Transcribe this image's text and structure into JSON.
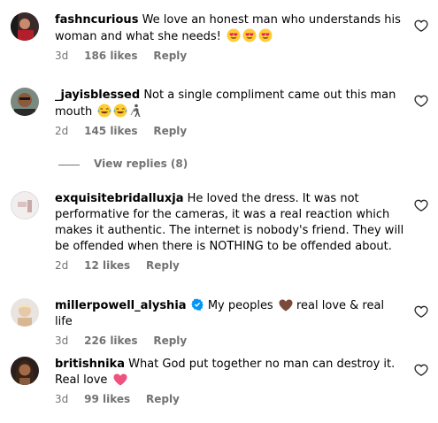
{
  "comments": [
    {
      "username": "fashncurious",
      "text": "We love an honest man who understands his woman and what she needs!",
      "emoji": [
        "heart-eyes",
        "heart-eyes",
        "heart-eyes"
      ],
      "time": "3d",
      "likes": "186 likes",
      "reply": "Reply"
    },
    {
      "username": "_jayisblessed",
      "text": "Not a single compliment came out this man mouth",
      "emoji": [
        "tears-of-joy",
        "tears-of-joy",
        "person-walking"
      ],
      "time": "2d",
      "likes": "145 likes",
      "reply": "Reply"
    },
    {
      "username": "exquisitebridalluxja",
      "text": "He loved the dress. It was not performative for the cameras, it was a real reaction which makes it authentic. The internet is nobody's friend. They will be offended when there is NOTHING to be offended about.",
      "time": "2d",
      "likes": "12 likes",
      "reply": "Reply"
    },
    {
      "username": "millerpowell_alyshia",
      "text_before": "My peoples",
      "text_after": "real love & real life",
      "verified": true,
      "emoji": [
        "brown-heart"
      ],
      "time": "3d",
      "likes": "226 likes",
      "reply": "Reply"
    },
    {
      "username": "britishnika",
      "text": "What God put together no man can destroy it. Real love",
      "emoji": [
        "pink-heart"
      ],
      "time": "3d",
      "likes": "99 likes",
      "reply": "Reply"
    }
  ],
  "view_replies": "View replies (8)",
  "colors": {
    "text": "#000000",
    "meta": "#737373",
    "verified": "#0095f6",
    "heart_outline": "#262626"
  }
}
